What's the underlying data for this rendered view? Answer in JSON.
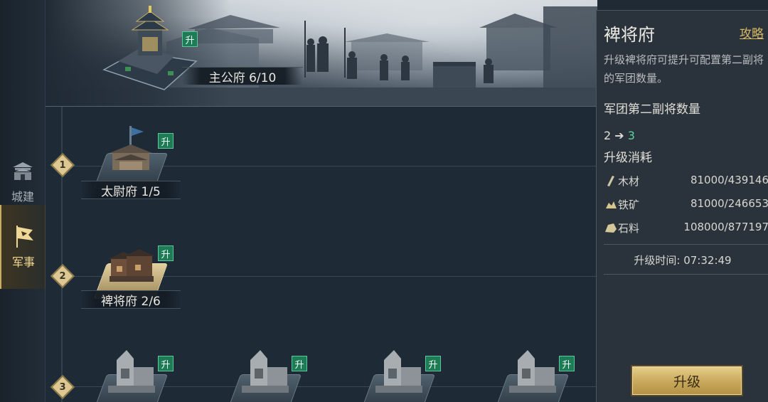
{
  "nav": {
    "city": {
      "label": "城建",
      "icon": "city-gate-icon"
    },
    "military": {
      "label": "军事",
      "icon": "war-flag-icon",
      "active": true
    }
  },
  "main_building": {
    "name": "主公府 6/10",
    "upgrade_badge": "升"
  },
  "tiers": [
    {
      "num": "1"
    },
    {
      "num": "2"
    },
    {
      "num": "3"
    }
  ],
  "nodes": {
    "taiwei": {
      "name": "太尉府 1/5",
      "badge": "升"
    },
    "pijiang": {
      "name": "裨将府 2/6",
      "badge": "升",
      "selected": true
    },
    "tier3": [
      {
        "badge": "升"
      },
      {
        "badge": "升"
      },
      {
        "badge": "升"
      },
      {
        "badge": "升"
      }
    ]
  },
  "panel": {
    "title": "裨将府",
    "guide_link": "攻略",
    "description": "升级裨将府可提升可配置第二副将的军团数量。",
    "count_title": "军团第二副将数量",
    "count_current": "2",
    "count_arrow": "➔",
    "count_next": "3",
    "cost_title": "升级消耗",
    "resources": [
      {
        "name": "木材",
        "amount": "81000/439146",
        "icon": "wood-icon"
      },
      {
        "name": "铁矿",
        "amount": "81000/246653",
        "icon": "iron-ore-icon"
      },
      {
        "name": "石料",
        "amount": "108000/877197",
        "icon": "stone-icon"
      }
    ],
    "time_label": "升级时间:",
    "time_value": "07:32:49",
    "upgrade_button": "升级"
  },
  "colors": {
    "accent_gold": "#d8b862",
    "upgrade_green": "#1f7a56",
    "next_value_green": "#5ed49a",
    "panel_bg": "#2a333c"
  }
}
